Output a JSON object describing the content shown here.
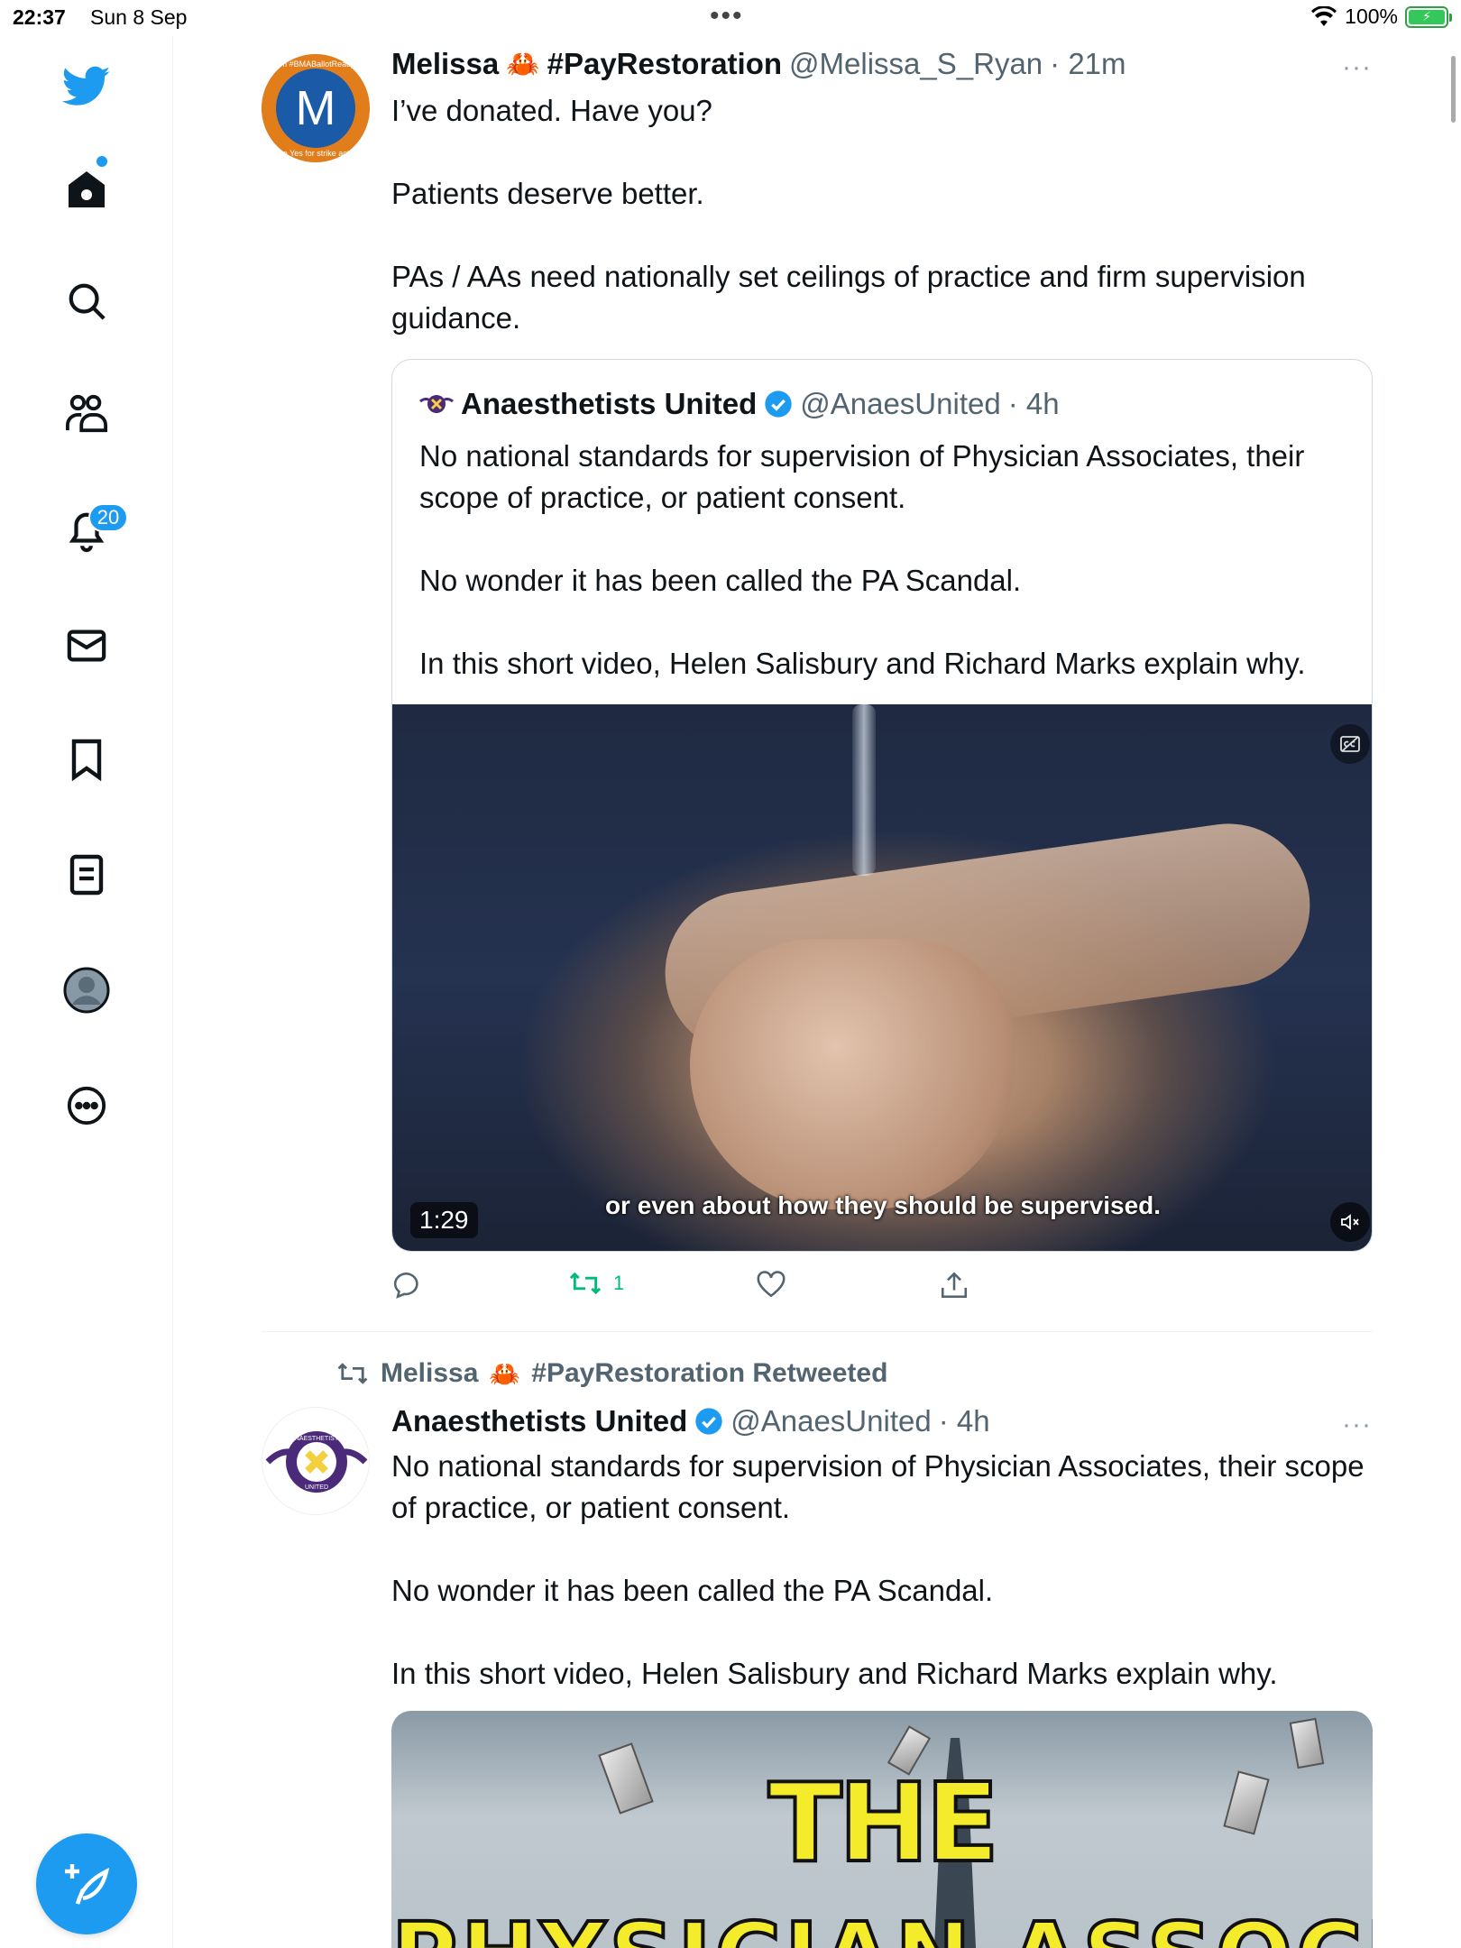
{
  "status_bar": {
    "time": "22:37",
    "date": "Sun 8 Sep",
    "battery": "100%"
  },
  "sidebar": {
    "items": [
      {
        "name": "twitter-logo"
      },
      {
        "name": "home"
      },
      {
        "name": "explore"
      },
      {
        "name": "communities"
      },
      {
        "name": "notifications",
        "badge": "20"
      },
      {
        "name": "messages"
      },
      {
        "name": "bookmarks"
      },
      {
        "name": "lists"
      },
      {
        "name": "profile"
      },
      {
        "name": "more"
      }
    ],
    "compose_icon": "feather-plus-icon"
  },
  "tweet1": {
    "avatar_letter": "M",
    "avatar_ring_top": "I'm #BMABallotReady",
    "avatar_ring_bottom": "Vote Yes for strike action",
    "name": "Melissa",
    "name_tag": "#PayRestoration",
    "handle": "@Melissa_S_Ryan",
    "time": "· 21m",
    "more": "···",
    "text": "I’ve donated. Have you?\n\nPatients deserve better.\n\nPAs / AAs need nationally set ceilings of practice and firm supervision guidance.",
    "quote": {
      "name": "Anaesthetists United",
      "handle": "@AnaesUnited",
      "time": "· 4h",
      "text": "No national standards for supervision of Physician Associates, their scope of practice, or patient consent.\n\nNo wonder it has been called the PA Scandal.\n\nIn this short video, Helen Salisbury and Richard Marks explain why.",
      "video": {
        "caption": "or even about how they should be supervised.",
        "duration": "1:29"
      }
    },
    "actions": {
      "replies": "",
      "retweets": "1",
      "likes": ""
    }
  },
  "tweet2": {
    "retweeted_by_name": "Melissa",
    "retweeted_by_tag": "#PayRestoration Retweeted",
    "name": "Anaesthetists United",
    "handle": "@AnaesUnited",
    "time": "· 4h",
    "more": "···",
    "avatar_ring_top": "ANAESTHETISTS",
    "avatar_ring_bottom": "UNITED",
    "text": "No national standards for supervision of Physician Associates, their scope of practice, or patient consent.\n\nNo wonder it has been called the PA Scandal.\n\nIn this short video, Helen Salisbury and Richard Marks explain why.",
    "media": {
      "title": "THE",
      "subtitle": "PHYSICIAN ASSOCIATE"
    }
  },
  "colors": {
    "accent": "#1d9bf0",
    "retweet_green": "#00ba7c",
    "muted": "#536471"
  }
}
